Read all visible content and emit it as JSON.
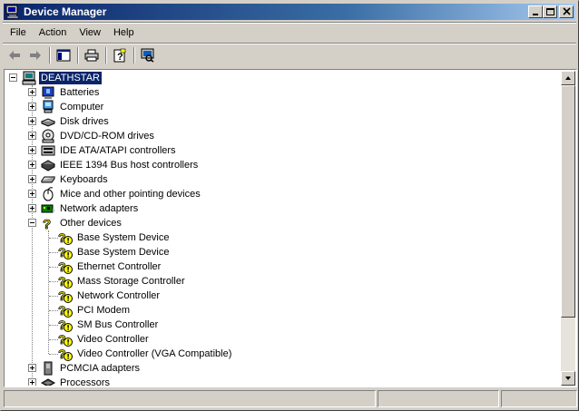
{
  "window": {
    "title": "Device Manager",
    "icons": {
      "app": "device-manager-icon",
      "minimize": "minimize-icon",
      "maximize": "maximize-icon",
      "close": "close-icon"
    }
  },
  "menu": [
    "File",
    "Action",
    "View",
    "Help"
  ],
  "toolbar": {
    "buttons": [
      "back-arrow-icon",
      "forward-arrow-icon",
      "show-hide-console-tree-icon",
      "print-icon",
      "properties-help-icon",
      "scan-hardware-icon"
    ]
  },
  "tree": {
    "root": "DEATHSTAR",
    "categories": [
      {
        "label": "Batteries",
        "icon": "battery-icon"
      },
      {
        "label": "Computer",
        "icon": "computer-icon"
      },
      {
        "label": "Disk drives",
        "icon": "disk-drive-icon"
      },
      {
        "label": "DVD/CD-ROM drives",
        "icon": "cdrom-icon"
      },
      {
        "label": "IDE ATA/ATAPI controllers",
        "icon": "ide-controller-icon"
      },
      {
        "label": "IEEE 1394 Bus host controllers",
        "icon": "ieee1394-icon"
      },
      {
        "label": "Keyboards",
        "icon": "keyboard-icon"
      },
      {
        "label": "Mice and other pointing devices",
        "icon": "mouse-icon"
      },
      {
        "label": "Network adapters",
        "icon": "network-adapter-icon"
      },
      {
        "label": "Other devices",
        "icon": "unknown-device-icon",
        "expanded": true
      }
    ],
    "other_devices": [
      "Base System Device",
      "Base System Device",
      "Ethernet Controller",
      "Mass Storage Controller",
      "Network Controller",
      "PCI Modem",
      "SM Bus Controller",
      "Video Controller",
      "Video Controller (VGA Compatible)"
    ],
    "after": [
      {
        "label": "PCMCIA adapters",
        "icon": "pcmcia-icon"
      },
      {
        "label": "Processors",
        "icon": "processor-icon"
      }
    ]
  },
  "colors": {
    "selection": "#0a246a",
    "warning_yellow": "#ffff00",
    "face": "#d4d0c8"
  }
}
